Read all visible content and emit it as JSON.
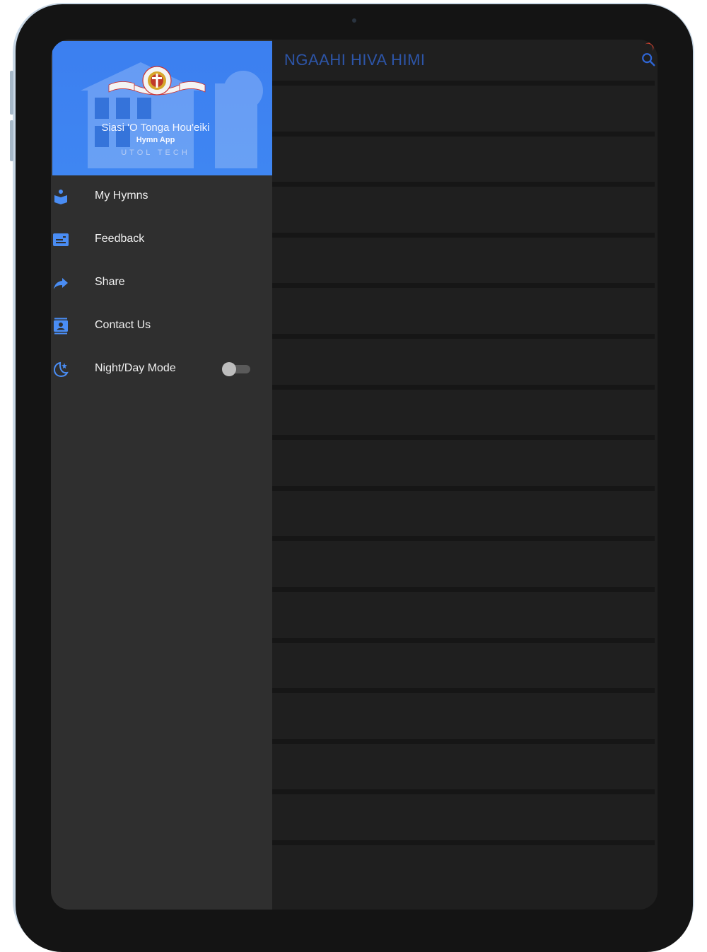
{
  "main": {
    "title": "NGAAHI HIVA HIMI",
    "row_count": 16
  },
  "drawer": {
    "header": {
      "app_name": "Siasi 'O Tonga Hou'eiki",
      "app_sub": "Hymn App",
      "app_tech": "UTOL TECH"
    },
    "items": [
      {
        "label": "My Hymns",
        "icon": "book-reader-icon"
      },
      {
        "label": "Feedback",
        "icon": "feedback-card-icon"
      },
      {
        "label": "Share",
        "icon": "share-arrow-icon"
      },
      {
        "label": "Contact Us",
        "icon": "contact-card-icon"
      },
      {
        "label": "Night/Day Mode",
        "icon": "moon-star-icon"
      }
    ],
    "night_mode_enabled": false
  },
  "colors": {
    "accent": "#3f86f2",
    "title_blue": "#2d55a8",
    "drawer_bg": "#2f2f2f",
    "main_bg": "#1f1f1f"
  }
}
